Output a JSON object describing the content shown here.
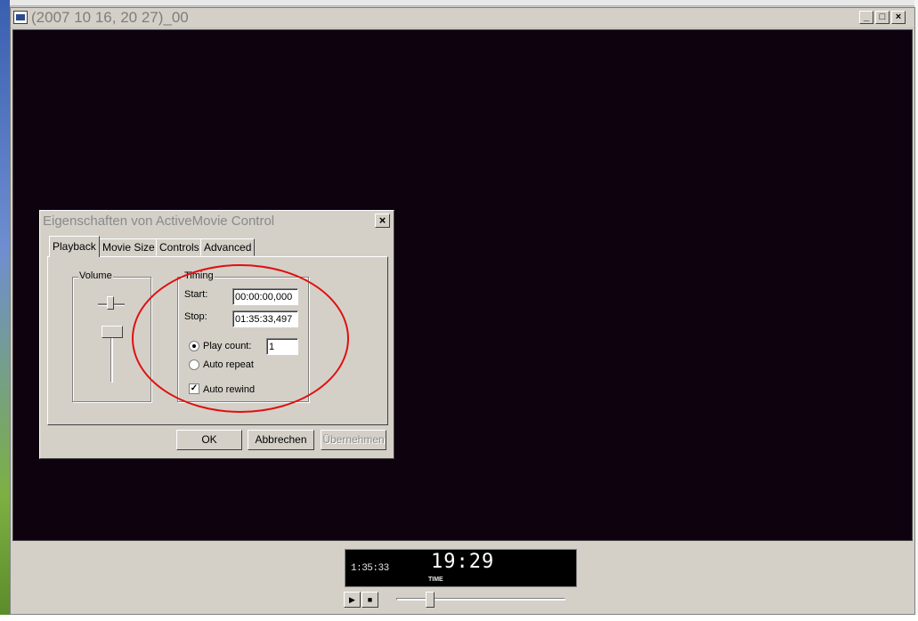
{
  "window": {
    "title": "(2007 10 16, 20 27)_00"
  },
  "dialog": {
    "title": "Eigenschaften von ActiveMovie Control",
    "tabs": [
      "Playback",
      "Movie Size",
      "Controls",
      "Advanced"
    ],
    "active_tab": "Playback",
    "volume": {
      "label": "Volume"
    },
    "timing": {
      "label": "Timing",
      "start_label": "Start:",
      "start_value": "00:00:00,000",
      "stop_label": "Stop:",
      "stop_value": "01:35:33,497",
      "play_count_label": "Play count:",
      "play_count_value": "1",
      "auto_repeat_label": "Auto repeat",
      "auto_rewind_label": "Auto rewind"
    },
    "buttons": {
      "ok": "OK",
      "cancel": "Abbrechen",
      "apply": "Übernehmen"
    }
  },
  "player": {
    "total_time": "1:35:33",
    "current_time": "19:29",
    "time_label": "TIME",
    "seek_position": 0.2
  },
  "colors": {
    "video_bg": "#0f020f",
    "annotation": "#e01010"
  }
}
